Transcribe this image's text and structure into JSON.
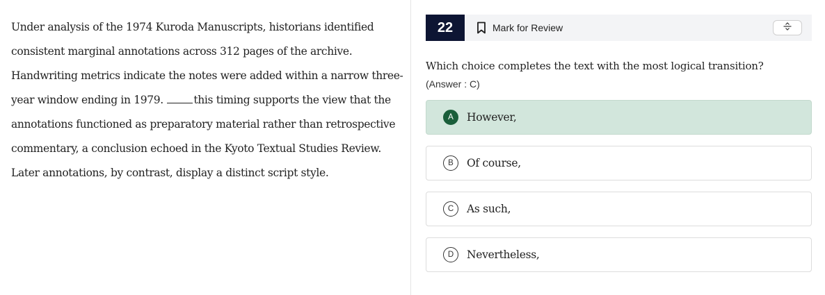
{
  "passage": {
    "before_blank": "Under analysis of the 1974 Kuroda Manuscripts, historians identified consistent marginal annotations across 312 pages of the archive. Handwriting metrics indicate the notes were added within a narrow three-year window ending in 1979.",
    "after_blank": "this timing supports the view that the annotations functioned as preparatory material rather than retrospective commentary, a conclusion echoed in the Kyoto Textual Studies Review. Later annotations, by contrast, display a distinct script style."
  },
  "question_bar": {
    "number": "22",
    "mark_review_label": "Mark for Review",
    "bookmark_icon": "bookmark-icon",
    "tool_icon": "strikethrough-icon"
  },
  "question": {
    "prompt": "Which choice completes the text with the most logical transition?",
    "answer_note": "(Answer : C)"
  },
  "choices": [
    {
      "letter": "A",
      "text": "However,",
      "selected": true
    },
    {
      "letter": "B",
      "text": "Of course,",
      "selected": false
    },
    {
      "letter": "C",
      "text": "As such,",
      "selected": false
    },
    {
      "letter": "D",
      "text": "Nevertheless,",
      "selected": false
    }
  ],
  "colors": {
    "question_number_bg": "#0d1533",
    "selected_choice_bg": "#d2e6dc",
    "selected_letter_bg": "#1a5e3a"
  }
}
